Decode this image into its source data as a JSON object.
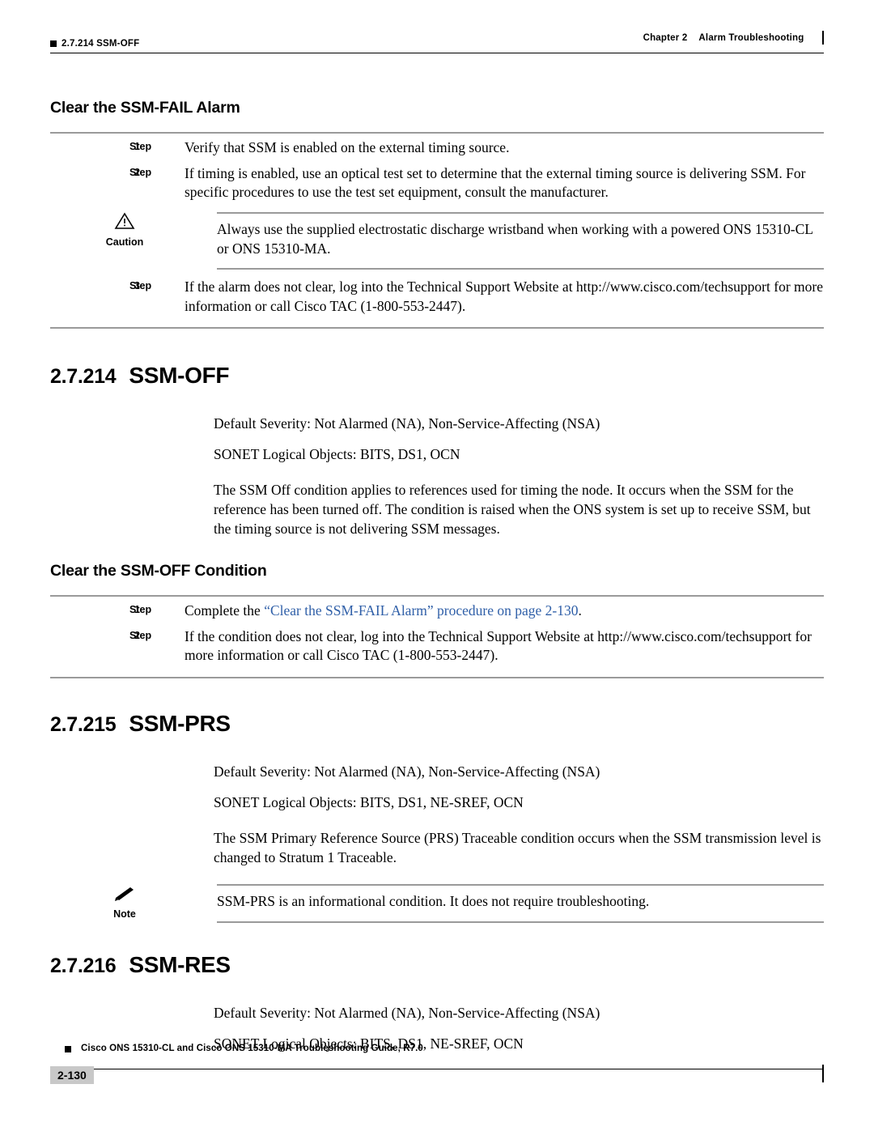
{
  "header": {
    "left_label": "2.7.214  SSM-OFF",
    "chapter": "Chapter 2",
    "chapter_title": "Alarm Troubleshooting"
  },
  "sections": [
    {
      "heading": "Clear the SSM-FAIL Alarm",
      "steps": [
        {
          "label": "Step",
          "num": "1",
          "text": "Verify that SSM is enabled on the external timing source."
        },
        {
          "label": "Step",
          "num": "2",
          "text": "If timing is enabled, use an optical test set to determine that the external timing source is delivering SSM. For specific procedures to use the test set equipment, consult the manufacturer."
        }
      ],
      "caution": {
        "word": "Caution",
        "icon": "caution-triangle-icon",
        "text": "Always use the supplied electrostatic discharge wristband when working with a powered ONS 15310-CL or ONS 15310-MA."
      },
      "steps_after": [
        {
          "label": "Step",
          "num": "3",
          "text": "If the alarm does not clear, log into the Technical Support Website at http://www.cisco.com/techsupport for more information or call Cisco TAC (1-800-553-2447)."
        }
      ]
    }
  ],
  "ssm_off": {
    "number": "2.7.214",
    "title": "SSM-OFF",
    "lines": [
      "Default Severity: Not Alarmed (NA), Non-Service-Affecting (NSA)",
      "SONET Logical Objects: BITS, DS1, OCN"
    ],
    "description": "The SSM Off condition applies to references used for timing the node. It occurs when the SSM for the reference has been turned off. The condition is raised when the ONS system is set up to receive SSM, but the timing source is not delivering SSM messages.",
    "clear_heading": "Clear the SSM-OFF Condition",
    "steps": [
      {
        "label": "Step",
        "num": "1",
        "text_before": "Complete the ",
        "link_text": "“Clear the SSM-FAIL Alarm” procedure on page 2-130",
        "text_after": "."
      },
      {
        "label": "Step",
        "num": "2",
        "text": "If the condition does not clear, log into the Technical Support Website at http://www.cisco.com/techsupport for more information or call Cisco TAC (1-800-553-2447)."
      }
    ]
  },
  "ssm_prs": {
    "number": "2.7.215",
    "title": "SSM-PRS",
    "lines": [
      "Default Severity: Not Alarmed (NA), Non-Service-Affecting (NSA)",
      "SONET Logical Objects: BITS, DS1, NE-SREF, OCN"
    ],
    "description": "The SSM Primary Reference Source (PRS) Traceable condition occurs when the SSM transmission level is changed to Stratum 1 Traceable.",
    "note": {
      "word": "Note",
      "icon": "note-pencil-icon",
      "text": "SSM-PRS is an informational condition. It does not require troubleshooting."
    }
  },
  "ssm_res": {
    "number": "2.7.216",
    "title": "SSM-RES",
    "lines": [
      "Default Severity: Not Alarmed (NA), Non-Service-Affecting (NSA)",
      "SONET Logical Objects: BITS, DS1, NE-SREF, OCN"
    ]
  },
  "footer": {
    "title": "Cisco ONS 15310-CL and Cisco ONS 15310-MA Troubleshooting Guide, R7.0",
    "page": "2-130"
  },
  "colors": {
    "link": "#2f5fa8",
    "rule": "#9a9a9a",
    "page_badge": "#c8c8c8"
  }
}
